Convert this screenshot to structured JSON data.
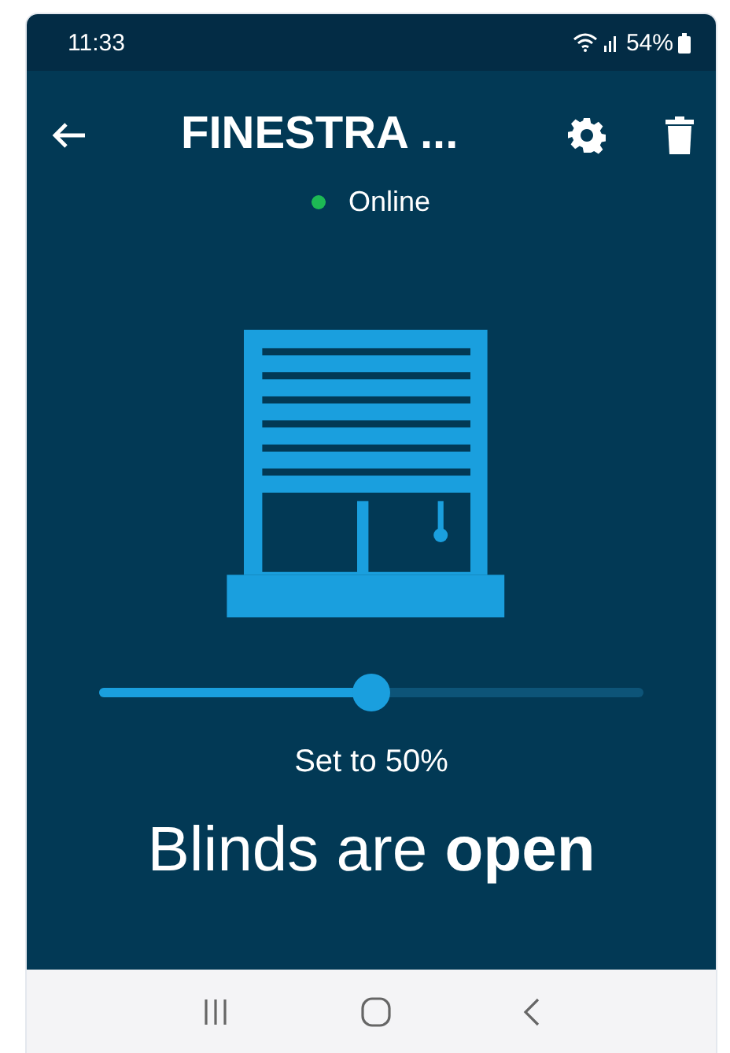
{
  "status_bar": {
    "time": "11:33",
    "battery": "54%"
  },
  "header": {
    "title": "FINESTRA ...",
    "status": {
      "label": "Online",
      "online": true
    }
  },
  "slider": {
    "level": 0.5,
    "reading": "Set to 50%"
  },
  "state_text": "Blinds are **open**"
}
